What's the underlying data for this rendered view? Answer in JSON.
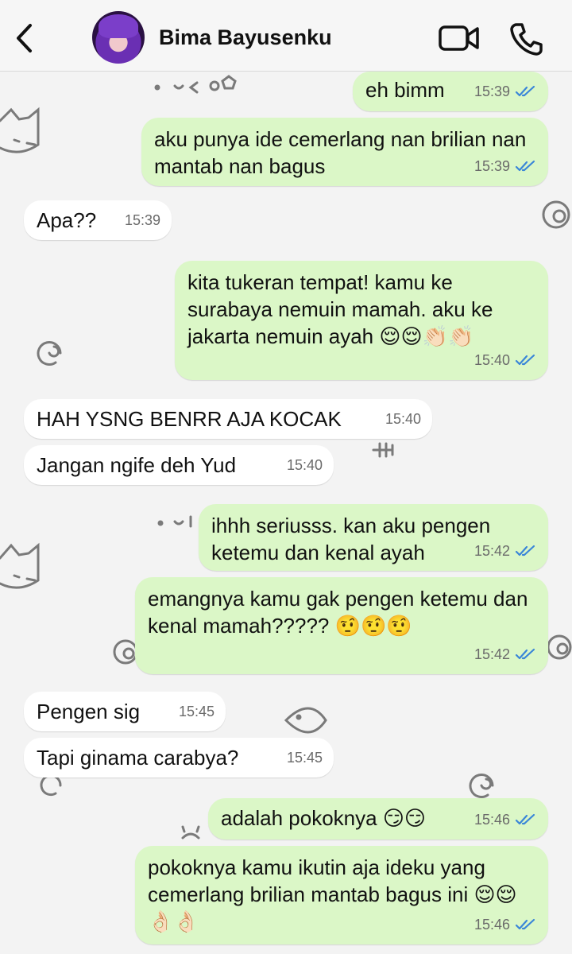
{
  "header": {
    "contact_name": "Bima Bayusenku"
  },
  "messages": [
    {
      "dir": "out",
      "text": "eh bimm",
      "time": "15:39",
      "read": true
    },
    {
      "dir": "out",
      "text": "aku punya ide cemerlang nan brilian nan mantab nan bagus",
      "time": "15:39",
      "read": true
    },
    {
      "dir": "in",
      "text": "Apa??",
      "time": "15:39"
    },
    {
      "dir": "out",
      "text": "kita tukeran tempat! kamu ke surabaya nemuin mamah. aku ke jakarta nemuin ayah 😌😌👏🏻👏🏻",
      "time": "15:40",
      "read": true
    },
    {
      "dir": "in",
      "text": "HAH YSNG BENRR AJA KOCAK",
      "time": "15:40"
    },
    {
      "dir": "in",
      "text": "Jangan ngife deh Yud",
      "time": "15:40"
    },
    {
      "dir": "out",
      "text": "ihhh seriusss. kan aku pengen ketemu dan kenal ayah",
      "time": "15:42",
      "read": true
    },
    {
      "dir": "out",
      "text": "emangnya kamu gak pengen ketemu dan kenal mamah????? 🤨🤨🤨",
      "time": "15:42",
      "read": true
    },
    {
      "dir": "in",
      "text": "Pengen sig",
      "time": "15:45"
    },
    {
      "dir": "in",
      "text": "Tapi ginama carabya?",
      "time": "15:45"
    },
    {
      "dir": "out",
      "text": "adalah pokoknya 😏😏",
      "time": "15:46",
      "read": true
    },
    {
      "dir": "out",
      "text": "pokoknya kamu ikutin aja ideku yang cemerlang brilian mantab bagus ini 😌😌👌🏻👌🏻",
      "time": "15:46",
      "read": true
    }
  ],
  "colors": {
    "outgoing_bubble": "#dbf7c7",
    "incoming_bubble": "#ffffff",
    "read_ticks": "#3a86d8"
  },
  "icons": [
    "back-chevron-icon",
    "video-call-icon",
    "phone-icon",
    "double-check-icon"
  ]
}
